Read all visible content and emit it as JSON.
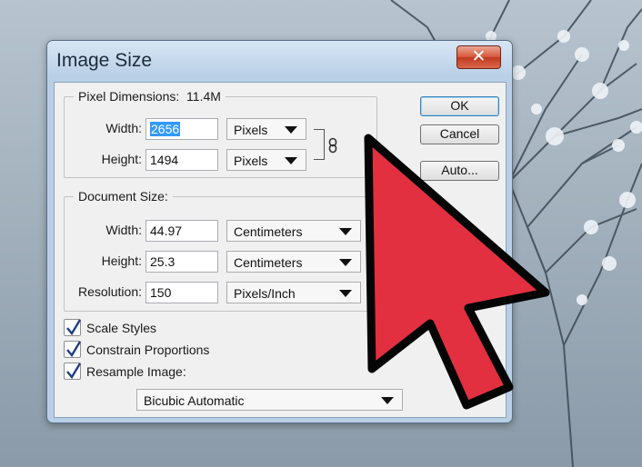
{
  "dialog": {
    "title": "Image Size",
    "close_label": "✕"
  },
  "pixel_dimensions": {
    "label": "Pixel Dimensions:",
    "size": "11.4M",
    "width": {
      "label": "Width:",
      "value": "2656",
      "unit": "Pixels"
    },
    "height": {
      "label": "Height:",
      "value": "1494",
      "unit": "Pixels"
    }
  },
  "document_size": {
    "label": "Document Size:",
    "width": {
      "label": "Width:",
      "value": "44.97",
      "unit": "Centimeters"
    },
    "height": {
      "label": "Height:",
      "value": "25.3",
      "unit": "Centimeters"
    },
    "resolution": {
      "label": "Resolution:",
      "value": "150",
      "unit": "Pixels/Inch"
    }
  },
  "buttons": {
    "ok": "OK",
    "cancel": "Cancel",
    "auto": "Auto..."
  },
  "options": {
    "scale_styles": {
      "label": "Scale Styles",
      "checked": true
    },
    "constrain_proportions": {
      "label": "Constrain Proportions",
      "checked": true
    },
    "resample_image": {
      "label": "Resample Image:",
      "checked": true
    },
    "resample_method": "Bicubic Automatic"
  },
  "colors": {
    "pointer": "#e23040",
    "accent": "#3399ff"
  }
}
